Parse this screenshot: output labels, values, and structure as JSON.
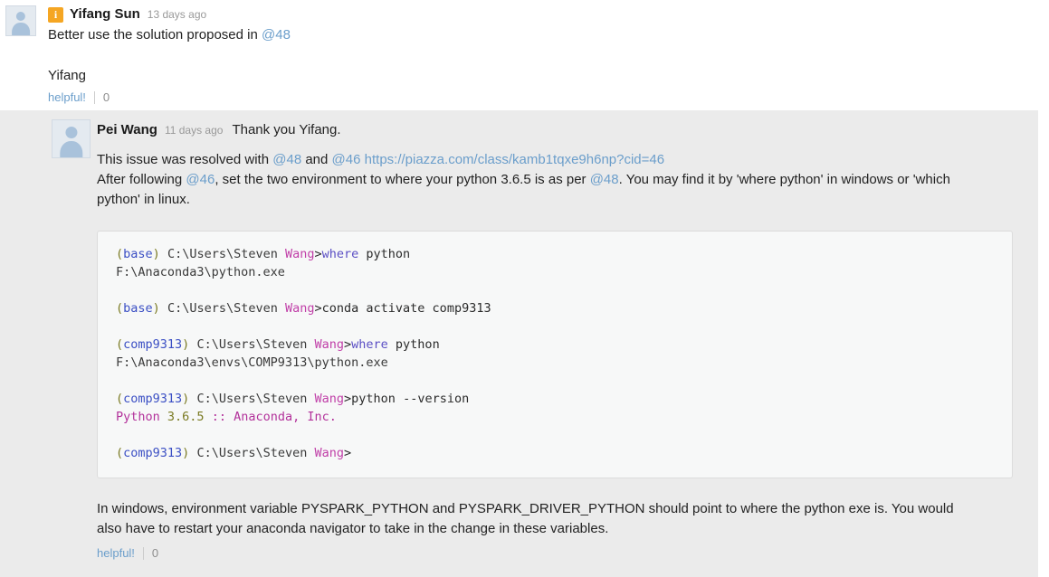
{
  "root_post": {
    "role_badge": "i",
    "role_badge_name": "instructor-badge",
    "author": "Yifang Sun",
    "timestamp": "13 days ago",
    "body_before_link": "Better use the solution proposed in ",
    "body_link": "@48",
    "signature": "Yifang",
    "helpful_label": "helpful!",
    "helpful_count": "0"
  },
  "reply_post": {
    "author": "Pei Wang",
    "timestamp": "11 days ago",
    "greeting": "Thank you Yifang.",
    "line1": {
      "part1": "This issue was resolved with ",
      "link1": "@48",
      "part2": " and ",
      "link2": "@46",
      "part3": " ",
      "url": "https://piazza.com/class/kamb1tqxe9h6np?cid=46"
    },
    "line2": {
      "part1": "After following ",
      "link1": "@46",
      "part2": ", set the two environment to where your python 3.6.5 is as per ",
      "link2": "@48",
      "part3": ". You may find it by 'where python' in windows or 'which"
    },
    "line3": "python' in linux.",
    "closing": {
      "line1": "In windows, environment variable PYSPARK_PYTHON and PYSPARK_DRIVER_PYTHON should point to where the python exe is. You would",
      "line2": "also have to restart your anaconda navigator to take in the change in these variables."
    },
    "helpful_label": "helpful!",
    "helpful_count": "0"
  },
  "code_block": {
    "lines": [
      {
        "type": "prompt",
        "env": "base",
        "path": "C:\\Users\\Steven ",
        "user": "Wang",
        "cmd": "where",
        "args": " python"
      },
      {
        "type": "output",
        "text": "F:\\Anaconda3\\python.exe"
      },
      {
        "type": "blank"
      },
      {
        "type": "prompt",
        "env": "base",
        "path": "C:\\Users\\Steven ",
        "user": "Wang",
        "cmd": "conda",
        "args": " activate comp9313",
        "plaincmd": true
      },
      {
        "type": "blank"
      },
      {
        "type": "prompt",
        "env": "comp9313",
        "path": "C:\\Users\\Steven ",
        "user": "Wang",
        "cmd": "where",
        "args": " python"
      },
      {
        "type": "output",
        "text": "F:\\Anaconda3\\envs\\COMP9313\\python.exe"
      },
      {
        "type": "blank"
      },
      {
        "type": "prompt",
        "env": "comp9313",
        "path": "C:\\Users\\Steven ",
        "user": "Wang",
        "cmd": "python",
        "args": " --version",
        "plaincmd": true
      },
      {
        "type": "version",
        "name": "Python",
        "number": " 3.6.5",
        "rest": " :: Anaconda, Inc."
      },
      {
        "type": "blank"
      },
      {
        "type": "prompt",
        "env": "comp9313",
        "path": "C:\\Users\\Steven ",
        "user": "Wang",
        "cmd": "",
        "args": ""
      }
    ]
  },
  "colors": {
    "link": "#6b9ecb",
    "badge": "#f5a623",
    "panel": "#ebebeb",
    "code_bg": "#f7f8f8"
  }
}
